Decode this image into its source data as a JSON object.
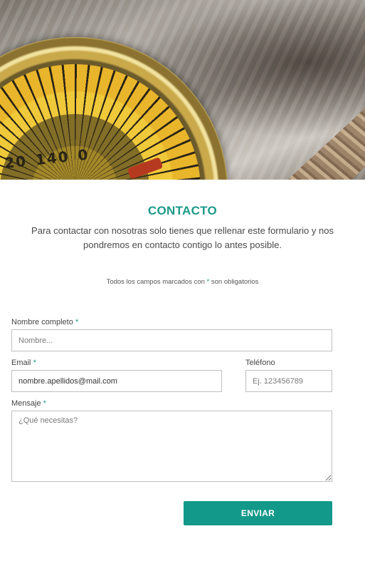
{
  "page": {
    "title": "CONTACTO",
    "intro": "Para contactar con nosotras solo tienes que rellenar este formulario y nos pondremos en contacto contigo lo antes posible.",
    "required_note_prefix": "Todos los campos marcados con ",
    "required_note_asterisk": "*",
    "required_note_suffix": " son obligatorios"
  },
  "hero": {
    "image": "compass-on-map-photo",
    "dial_numbers": [
      "20",
      "140",
      "0"
    ]
  },
  "colors": {
    "accent": "#1a9a89",
    "button": "#13998a"
  },
  "form": {
    "name": {
      "label": "Nombre completo",
      "required": "*",
      "placeholder": "Nombre...",
      "value": ""
    },
    "email": {
      "label": "Email",
      "required": "*",
      "placeholder": "",
      "value": "nombre.apellidos@mail.com"
    },
    "phone": {
      "label": "Teléfono",
      "placeholder": "Ej. 123456789",
      "value": ""
    },
    "message": {
      "label": "Mensaje",
      "required": "*",
      "placeholder": "¿Qué necesitas?",
      "value": ""
    },
    "submit_label": "ENVIAR"
  }
}
